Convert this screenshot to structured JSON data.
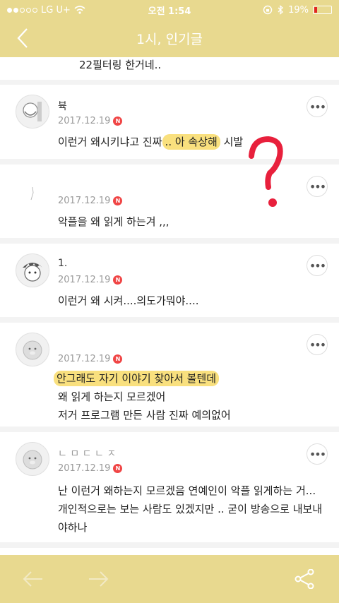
{
  "status": {
    "carrier": "LG U+",
    "time": "오전 1:54",
    "battery": "19%",
    "battery_level": 0.19
  },
  "nav": {
    "title": "1시, 인기글"
  },
  "top_snippet": "22필터링 한거네..",
  "comments": [
    {
      "author": "뷱",
      "date": "2017.12.19",
      "badge": "N",
      "text_pre": "이런거 왜시키냐고 진짜",
      "text_hl": ".. 아 속상해",
      "text_post": " 시발"
    },
    {
      "author": "",
      "date": "2017.12.19",
      "badge": "N",
      "text": "악플을 왜 읽게 하는겨 ,,,"
    },
    {
      "author": "1.",
      "date": "2017.12.19",
      "badge": "N",
      "text": "이런거 왜 시켜....의도가뭐야...."
    },
    {
      "author": "",
      "date": "2017.12.19",
      "badge": "N",
      "text_hl": "안그래도 자기 이야기 찾아서 볼텐데",
      "line2": "왜 읽게 하는지 모르겠어",
      "line3": "저거 프로그램 만든 사람 진짜 예의없어"
    },
    {
      "author": "ㄴ ㅁ ㄷ ㄴ ㅈ",
      "date": "2017.12.19",
      "badge": "N",
      "text": "난 이런거 왜하는지 모르겠음 연예인이 악플 읽게하는 거... 개인적으로는 보는 사람도 있겠지만 .. 굳이 방송으로 내보내야하나"
    }
  ],
  "colors": {
    "bar": "#e8d98f",
    "highlight": "#f9e07e",
    "annotation": "#e8203c",
    "badge": "#f04545"
  },
  "icons": {
    "back": "chevron-left-icon",
    "prev": "arrow-left-icon",
    "next": "arrow-right-icon",
    "share": "share-icon",
    "more": "more-horizontal-icon"
  }
}
